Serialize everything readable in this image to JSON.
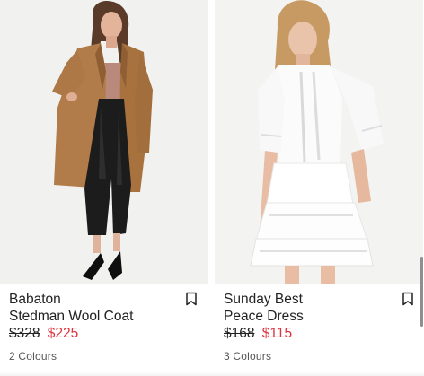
{
  "products": [
    {
      "brand": "Babaton",
      "name": "Stedman Wool Coat",
      "price_original": "$328",
      "price_sale": "$225",
      "colours": "2 Colours",
      "image_alt": "Model wearing camel wool coat with black leather pants"
    },
    {
      "brand": "Sunday Best",
      "name": "Peace Dress",
      "price_original": "$168",
      "price_sale": "$115",
      "colours": "3 Colours",
      "image_alt": "Model wearing white lace mini dress"
    }
  ],
  "icons": {
    "bookmark": "bookmark-icon"
  },
  "colors": {
    "sale_price": "#e0323c",
    "text": "#222222",
    "muted": "#555555"
  }
}
